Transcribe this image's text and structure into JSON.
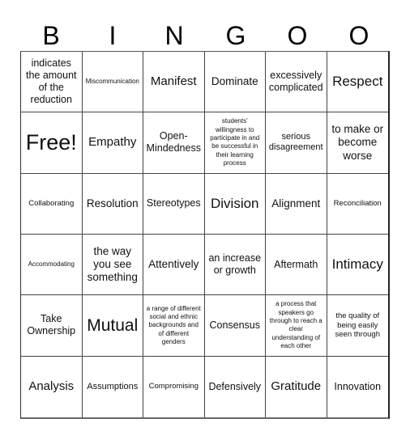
{
  "title_letters": [
    "B",
    "I",
    "N",
    "G",
    "O",
    "O"
  ],
  "cells": [
    [
      "indicates the amount of the reduction",
      "Miscommunication",
      "Manifest",
      "Dominate",
      "excessively complicated",
      "Respect"
    ],
    [
      "Free!",
      "Empathy",
      "Open-Mindedness",
      "students' willingness to participate in and be successful in their learning process",
      "serious disagreement",
      "to make or become worse"
    ],
    [
      "Collaborating",
      "Resolution",
      "Stereotypes",
      "Division",
      "Alignment",
      "Reconciliation"
    ],
    [
      "Accommodating",
      "the way you see something",
      "Attentively",
      "an increase or growth",
      "Aftermath",
      "Intimacy"
    ],
    [
      "Take Ownership",
      "Mutual",
      "a range of different social and ethnic backgrounds and of different genders",
      "Consensus",
      "a process that speakers go through to reach a clear understanding of each other",
      "the quality of being easily seen through"
    ],
    [
      "Analysis",
      "Assumptions",
      "Compromising",
      "Defensively",
      "Gratitude",
      "Innovation"
    ]
  ]
}
